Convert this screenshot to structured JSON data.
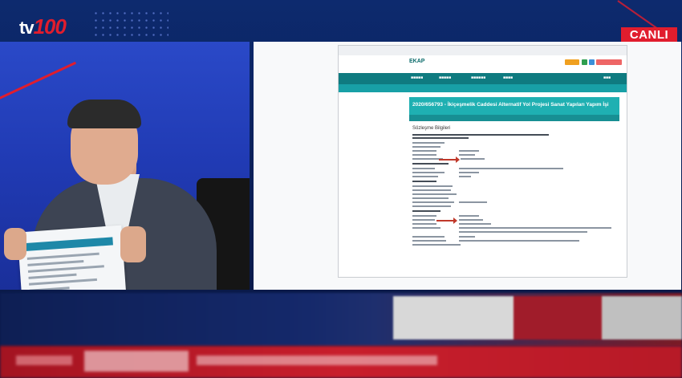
{
  "channel": {
    "logo_prefix": "tv",
    "logo_number": "100"
  },
  "badge": {
    "live": "CANLI"
  },
  "document": {
    "site_logo": "EKAP",
    "title": "2020/656793 - İkiçeşmelik Caddesi Alternatif Yol Projesi Sanat Yapıları Yapım İşi",
    "section_heading": "Sözleşme Bilgileri"
  },
  "colors": {
    "live_red": "#e11d2d",
    "brand_teal": "#0f7b80",
    "bg_navy": "#0d2a6e"
  }
}
